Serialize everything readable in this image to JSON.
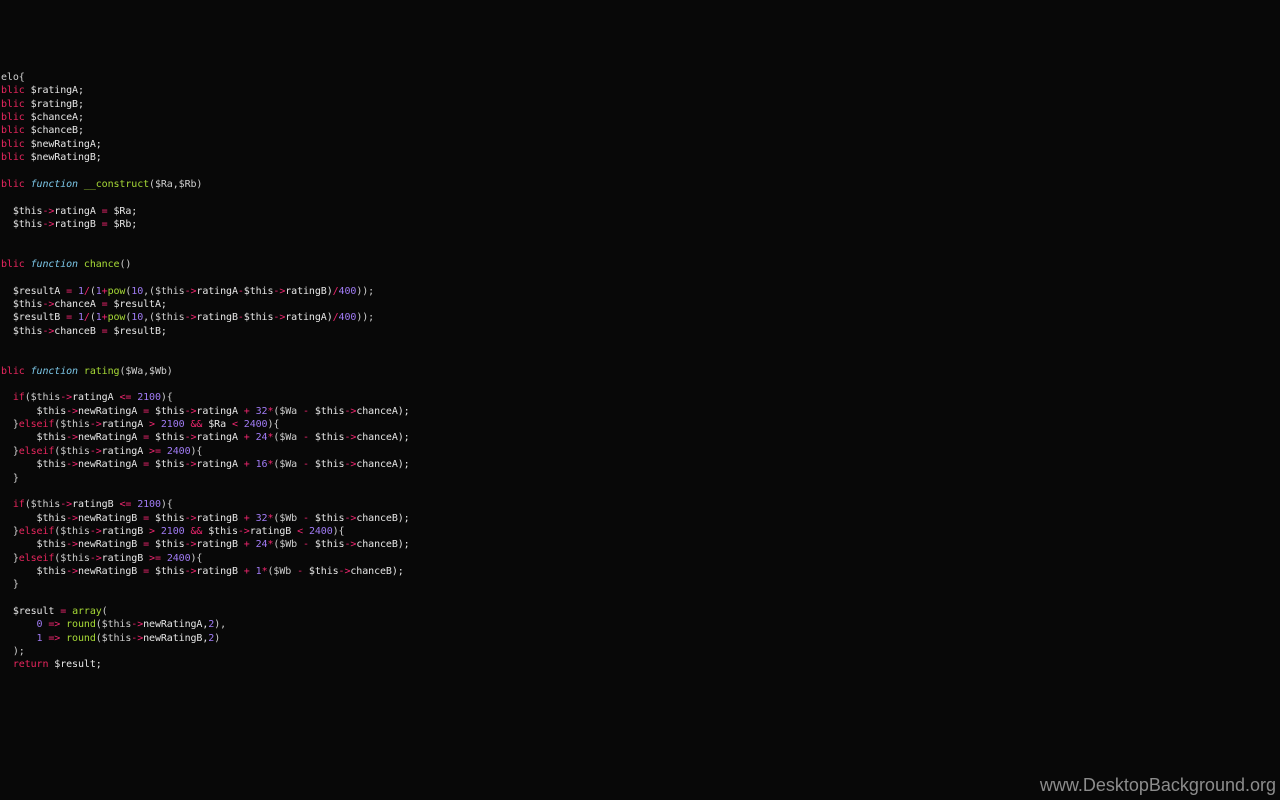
{
  "colors": {
    "background": "#080808",
    "keyword": "#e8265e",
    "operator": "#f0266f",
    "number": "#a07bf4",
    "function_name": "#a6d936",
    "storage_italic": "#7cc7e8",
    "plain": "#e6e6e6"
  },
  "lines": [
    [
      [
        "pun",
        "elo{"
      ]
    ],
    [
      [
        "kw",
        "blic"
      ],
      [
        "var",
        " $ratingA;"
      ]
    ],
    [
      [
        "kw",
        "blic"
      ],
      [
        "var",
        " $ratingB;"
      ]
    ],
    [
      [
        "kw",
        "blic"
      ],
      [
        "var",
        " $chanceA;"
      ]
    ],
    [
      [
        "kw",
        "blic"
      ],
      [
        "var",
        " $chanceB;"
      ]
    ],
    [
      [
        "kw",
        "blic"
      ],
      [
        "var",
        " $newRatingA;"
      ]
    ],
    [
      [
        "kw",
        "blic"
      ],
      [
        "var",
        " $newRatingB;"
      ]
    ],
    [],
    [
      [
        "kw",
        "blic"
      ],
      [
        "pun",
        " "
      ],
      [
        "it",
        "function"
      ],
      [
        "pun",
        " "
      ],
      [
        "fn",
        "__construct"
      ],
      [
        "pun",
        "($Ra,$Rb)"
      ]
    ],
    [],
    [
      [
        "var",
        "  $this"
      ],
      [
        "op",
        "->"
      ],
      [
        "var",
        "ratingA "
      ],
      [
        "op",
        "="
      ],
      [
        "var",
        " $Ra;"
      ]
    ],
    [
      [
        "var",
        "  $this"
      ],
      [
        "op",
        "->"
      ],
      [
        "var",
        "ratingB "
      ],
      [
        "op",
        "="
      ],
      [
        "var",
        " $Rb;"
      ]
    ],
    [],
    [],
    [
      [
        "kw",
        "blic"
      ],
      [
        "pun",
        " "
      ],
      [
        "it",
        "function"
      ],
      [
        "pun",
        " "
      ],
      [
        "fn",
        "chance"
      ],
      [
        "pun",
        "()"
      ]
    ],
    [],
    [
      [
        "var",
        "  $resultA "
      ],
      [
        "op",
        "="
      ],
      [
        "pun",
        " "
      ],
      [
        "num",
        "1"
      ],
      [
        "op",
        "/"
      ],
      [
        "pun",
        "("
      ],
      [
        "num",
        "1"
      ],
      [
        "op",
        "+"
      ],
      [
        "fn",
        "pow"
      ],
      [
        "pun",
        "("
      ],
      [
        "num",
        "10"
      ],
      [
        "pun",
        ",($this"
      ],
      [
        "op",
        "->"
      ],
      [
        "var",
        "ratingA"
      ],
      [
        "op",
        "-"
      ],
      [
        "var",
        "$this"
      ],
      [
        "op",
        "->"
      ],
      [
        "var",
        "ratingB)"
      ],
      [
        "op",
        "/"
      ],
      [
        "num",
        "400"
      ],
      [
        "pun",
        "));"
      ]
    ],
    [
      [
        "var",
        "  $this"
      ],
      [
        "op",
        "->"
      ],
      [
        "var",
        "chanceA "
      ],
      [
        "op",
        "="
      ],
      [
        "var",
        " $resultA;"
      ]
    ],
    [
      [
        "var",
        "  $resultB "
      ],
      [
        "op",
        "="
      ],
      [
        "pun",
        " "
      ],
      [
        "num",
        "1"
      ],
      [
        "op",
        "/"
      ],
      [
        "pun",
        "("
      ],
      [
        "num",
        "1"
      ],
      [
        "op",
        "+"
      ],
      [
        "fn",
        "pow"
      ],
      [
        "pun",
        "("
      ],
      [
        "num",
        "10"
      ],
      [
        "pun",
        ",($this"
      ],
      [
        "op",
        "->"
      ],
      [
        "var",
        "ratingB"
      ],
      [
        "op",
        "-"
      ],
      [
        "var",
        "$this"
      ],
      [
        "op",
        "->"
      ],
      [
        "var",
        "ratingA)"
      ],
      [
        "op",
        "/"
      ],
      [
        "num",
        "400"
      ],
      [
        "pun",
        "));"
      ]
    ],
    [
      [
        "var",
        "  $this"
      ],
      [
        "op",
        "->"
      ],
      [
        "var",
        "chanceB "
      ],
      [
        "op",
        "="
      ],
      [
        "var",
        " $resultB;"
      ]
    ],
    [],
    [],
    [
      [
        "kw",
        "blic"
      ],
      [
        "pun",
        " "
      ],
      [
        "it",
        "function"
      ],
      [
        "pun",
        " "
      ],
      [
        "fn",
        "rating"
      ],
      [
        "pun",
        "($Wa,$Wb)"
      ]
    ],
    [],
    [
      [
        "pun",
        "  "
      ],
      [
        "kw",
        "if"
      ],
      [
        "pun",
        "($this"
      ],
      [
        "op",
        "->"
      ],
      [
        "var",
        "ratingA "
      ],
      [
        "op",
        "<="
      ],
      [
        "pun",
        " "
      ],
      [
        "num",
        "2100"
      ],
      [
        "pun",
        "){"
      ]
    ],
    [
      [
        "var",
        "      $this"
      ],
      [
        "op",
        "->"
      ],
      [
        "var",
        "newRatingA "
      ],
      [
        "op",
        "="
      ],
      [
        "var",
        " $this"
      ],
      [
        "op",
        "->"
      ],
      [
        "var",
        "ratingA "
      ],
      [
        "op",
        "+"
      ],
      [
        "pun",
        " "
      ],
      [
        "num",
        "32"
      ],
      [
        "op",
        "*"
      ],
      [
        "pun",
        "($Wa "
      ],
      [
        "op",
        "-"
      ],
      [
        "var",
        " $this"
      ],
      [
        "op",
        "->"
      ],
      [
        "var",
        "chanceA);"
      ]
    ],
    [
      [
        "pun",
        "  }"
      ],
      [
        "kw",
        "elseif"
      ],
      [
        "pun",
        "($this"
      ],
      [
        "op",
        "->"
      ],
      [
        "var",
        "ratingA "
      ],
      [
        "op",
        ">"
      ],
      [
        "pun",
        " "
      ],
      [
        "num",
        "2100"
      ],
      [
        "pun",
        " "
      ],
      [
        "op",
        "&&"
      ],
      [
        "var",
        " $Ra "
      ],
      [
        "op",
        "<"
      ],
      [
        "pun",
        " "
      ],
      [
        "num",
        "2400"
      ],
      [
        "pun",
        "){"
      ]
    ],
    [
      [
        "var",
        "      $this"
      ],
      [
        "op",
        "->"
      ],
      [
        "var",
        "newRatingA "
      ],
      [
        "op",
        "="
      ],
      [
        "var",
        " $this"
      ],
      [
        "op",
        "->"
      ],
      [
        "var",
        "ratingA "
      ],
      [
        "op",
        "+"
      ],
      [
        "pun",
        " "
      ],
      [
        "num",
        "24"
      ],
      [
        "op",
        "*"
      ],
      [
        "pun",
        "($Wa "
      ],
      [
        "op",
        "-"
      ],
      [
        "var",
        " $this"
      ],
      [
        "op",
        "->"
      ],
      [
        "var",
        "chanceA);"
      ]
    ],
    [
      [
        "pun",
        "  }"
      ],
      [
        "kw",
        "elseif"
      ],
      [
        "pun",
        "($this"
      ],
      [
        "op",
        "->"
      ],
      [
        "var",
        "ratingA "
      ],
      [
        "op",
        ">="
      ],
      [
        "pun",
        " "
      ],
      [
        "num",
        "2400"
      ],
      [
        "pun",
        "){"
      ]
    ],
    [
      [
        "var",
        "      $this"
      ],
      [
        "op",
        "->"
      ],
      [
        "var",
        "newRatingA "
      ],
      [
        "op",
        "="
      ],
      [
        "var",
        " $this"
      ],
      [
        "op",
        "->"
      ],
      [
        "var",
        "ratingA "
      ],
      [
        "op",
        "+"
      ],
      [
        "pun",
        " "
      ],
      [
        "num",
        "16"
      ],
      [
        "op",
        "*"
      ],
      [
        "pun",
        "($Wa "
      ],
      [
        "op",
        "-"
      ],
      [
        "var",
        " $this"
      ],
      [
        "op",
        "->"
      ],
      [
        "var",
        "chanceA);"
      ]
    ],
    [
      [
        "pun",
        "  }"
      ]
    ],
    [],
    [
      [
        "pun",
        "  "
      ],
      [
        "kw",
        "if"
      ],
      [
        "pun",
        "($this"
      ],
      [
        "op",
        "->"
      ],
      [
        "var",
        "ratingB "
      ],
      [
        "op",
        "<="
      ],
      [
        "pun",
        " "
      ],
      [
        "num",
        "2100"
      ],
      [
        "pun",
        "){"
      ]
    ],
    [
      [
        "var",
        "      $this"
      ],
      [
        "op",
        "->"
      ],
      [
        "var",
        "newRatingB "
      ],
      [
        "op",
        "="
      ],
      [
        "var",
        " $this"
      ],
      [
        "op",
        "->"
      ],
      [
        "var",
        "ratingB "
      ],
      [
        "op",
        "+"
      ],
      [
        "pun",
        " "
      ],
      [
        "num",
        "32"
      ],
      [
        "op",
        "*"
      ],
      [
        "pun",
        "($Wb "
      ],
      [
        "op",
        "-"
      ],
      [
        "var",
        " $this"
      ],
      [
        "op",
        "->"
      ],
      [
        "var",
        "chanceB);"
      ]
    ],
    [
      [
        "pun",
        "  }"
      ],
      [
        "kw",
        "elseif"
      ],
      [
        "pun",
        "($this"
      ],
      [
        "op",
        "->"
      ],
      [
        "var",
        "ratingB "
      ],
      [
        "op",
        ">"
      ],
      [
        "pun",
        " "
      ],
      [
        "num",
        "2100"
      ],
      [
        "pun",
        " "
      ],
      [
        "op",
        "&&"
      ],
      [
        "var",
        " $this"
      ],
      [
        "op",
        "->"
      ],
      [
        "var",
        "ratingB "
      ],
      [
        "op",
        "<"
      ],
      [
        "pun",
        " "
      ],
      [
        "num",
        "2400"
      ],
      [
        "pun",
        "){"
      ]
    ],
    [
      [
        "var",
        "      $this"
      ],
      [
        "op",
        "->"
      ],
      [
        "var",
        "newRatingB "
      ],
      [
        "op",
        "="
      ],
      [
        "var",
        " $this"
      ],
      [
        "op",
        "->"
      ],
      [
        "var",
        "ratingB "
      ],
      [
        "op",
        "+"
      ],
      [
        "pun",
        " "
      ],
      [
        "num",
        "24"
      ],
      [
        "op",
        "*"
      ],
      [
        "pun",
        "($Wb "
      ],
      [
        "op",
        "-"
      ],
      [
        "var",
        " $this"
      ],
      [
        "op",
        "->"
      ],
      [
        "var",
        "chanceB);"
      ]
    ],
    [
      [
        "pun",
        "  }"
      ],
      [
        "kw",
        "elseif"
      ],
      [
        "pun",
        "($this"
      ],
      [
        "op",
        "->"
      ],
      [
        "var",
        "ratingB "
      ],
      [
        "op",
        ">="
      ],
      [
        "pun",
        " "
      ],
      [
        "num",
        "2400"
      ],
      [
        "pun",
        "){"
      ]
    ],
    [
      [
        "var",
        "      $this"
      ],
      [
        "op",
        "->"
      ],
      [
        "var",
        "newRatingB "
      ],
      [
        "op",
        "="
      ],
      [
        "var",
        " $this"
      ],
      [
        "op",
        "->"
      ],
      [
        "var",
        "ratingB "
      ],
      [
        "op",
        "+"
      ],
      [
        "pun",
        " "
      ],
      [
        "num",
        "1"
      ],
      [
        "op",
        "*"
      ],
      [
        "pun",
        "($Wb "
      ],
      [
        "op",
        "-"
      ],
      [
        "var",
        " $this"
      ],
      [
        "op",
        "->"
      ],
      [
        "var",
        "chanceB);"
      ]
    ],
    [
      [
        "pun",
        "  }"
      ]
    ],
    [],
    [
      [
        "var",
        "  $result "
      ],
      [
        "op",
        "="
      ],
      [
        "pun",
        " "
      ],
      [
        "fn",
        "array"
      ],
      [
        "pun",
        "("
      ]
    ],
    [
      [
        "pun",
        "      "
      ],
      [
        "num",
        "0"
      ],
      [
        "pun",
        " "
      ],
      [
        "op",
        "=>"
      ],
      [
        "pun",
        " "
      ],
      [
        "fn",
        "round"
      ],
      [
        "pun",
        "($this"
      ],
      [
        "op",
        "->"
      ],
      [
        "var",
        "newRatingA,"
      ],
      [
        "num",
        "2"
      ],
      [
        "pun",
        "),"
      ]
    ],
    [
      [
        "pun",
        "      "
      ],
      [
        "num",
        "1"
      ],
      [
        "pun",
        " "
      ],
      [
        "op",
        "=>"
      ],
      [
        "pun",
        " "
      ],
      [
        "fn",
        "round"
      ],
      [
        "pun",
        "($this"
      ],
      [
        "op",
        "->"
      ],
      [
        "var",
        "newRatingB,"
      ],
      [
        "num",
        "2"
      ],
      [
        "pun",
        ")"
      ]
    ],
    [
      [
        "pun",
        "  );"
      ]
    ],
    [
      [
        "pun",
        "  "
      ],
      [
        "kw",
        "return"
      ],
      [
        "var",
        " $result;"
      ]
    ]
  ],
  "watermark": "www.DesktopBackground.org"
}
